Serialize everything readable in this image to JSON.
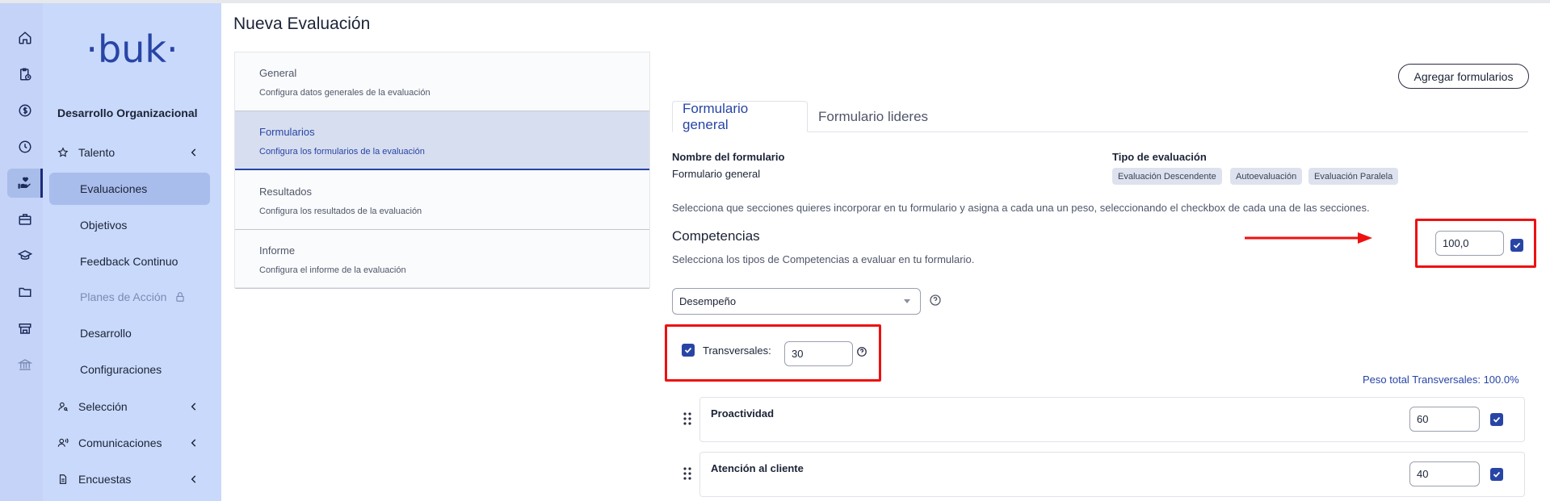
{
  "sidebar": {
    "logo": "·buk·",
    "module_title": "Desarrollo Organizacional",
    "items": [
      {
        "label": "Talento"
      },
      {
        "label": "Evaluaciones"
      },
      {
        "label": "Objetivos"
      },
      {
        "label": "Feedback Continuo"
      },
      {
        "label": "Planes de Acción"
      },
      {
        "label": "Desarrollo"
      },
      {
        "label": "Configuraciones"
      },
      {
        "label": "Selección"
      },
      {
        "label": "Comunicaciones"
      },
      {
        "label": "Encuestas"
      }
    ]
  },
  "rail_icons": [
    "home-icon",
    "clipboard-clock-icon",
    "dollar-icon",
    "clock-icon",
    "hand-heart-icon",
    "briefcase-icon",
    "graduation-cap-icon",
    "folder-icon",
    "store-icon",
    "bank-icon"
  ],
  "page_title": "Nueva Evaluación",
  "steps": [
    {
      "title": "General",
      "desc": "Configura datos generales de la evaluación"
    },
    {
      "title": "Formularios",
      "desc": "Configura los formularios de la evaluación"
    },
    {
      "title": "Resultados",
      "desc": "Configura los resultados de la evaluación"
    },
    {
      "title": "Informe",
      "desc": "Configura el informe de la evaluación"
    }
  ],
  "add_forms_label": "Agregar formularios",
  "tabs": [
    {
      "label": "Formulario general"
    },
    {
      "label": "Formulario lideres"
    }
  ],
  "form": {
    "name_label": "Nombre del formulario",
    "name_value": "Formulario general",
    "type_label": "Tipo de evaluación",
    "types": [
      "Evaluación Descendente",
      "Autoevaluación",
      "Evaluación Paralela"
    ],
    "sections_help": "Selecciona que secciones quieres incorporar en tu formulario y asigna a cada una un peso, seleccionando el checkbox de cada una de las secciones.",
    "competencias_title": "Competencias",
    "competencias_help": "Selecciona los tipos de Competencias a evaluar en tu formulario.",
    "competencias_weight": "100,0",
    "competency_type": "Desempeño",
    "transversales_label": "Transversales:",
    "transversales_value": "30",
    "peso_total": "Peso total Transversales: 100.0%",
    "competencies": [
      {
        "name": "Proactividad",
        "weight": "60"
      },
      {
        "name": "Atención al cliente",
        "weight": "40"
      }
    ]
  },
  "colors": {
    "primary": "#2845a6",
    "annotation": "#ee1111",
    "sidebar_bg": "#c9d9fb",
    "rail_bg": "#c4d3f7"
  }
}
